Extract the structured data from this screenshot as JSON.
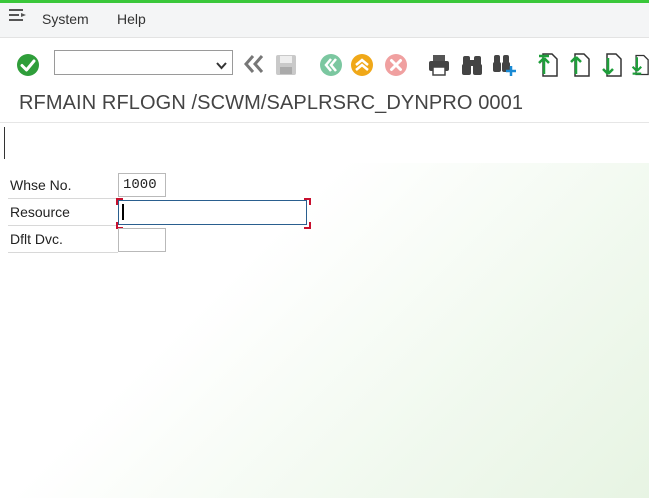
{
  "menu": {
    "system": "System",
    "help": "Help"
  },
  "toolbar": {
    "command_field": {
      "value": "",
      "placeholder": ""
    },
    "icons": [
      "enter-icon",
      "dropdown-icon",
      "double-left-icon",
      "save-icon",
      "back-icon",
      "exit-icon",
      "cancel-icon",
      "print-icon",
      "find-icon",
      "find-next-icon",
      "first-page-icon",
      "previous-page-icon",
      "next-page-icon",
      "last-page-icon"
    ]
  },
  "title": "RFMAIN RFLOGN /SCWM/SAPLRSRC_DYNPRO 0001",
  "form": {
    "whse_label": "Whse No.",
    "whse_value": "1000",
    "resource_label": "Resource",
    "resource_value": "",
    "dflt_label": "Dflt Dvc.",
    "dflt_value": ""
  },
  "colors": {
    "accent_green": "#3ac73a",
    "enter_green": "#2f9e3a",
    "back_green": "#7bc7a0",
    "exit_orange": "#f0a818",
    "cancel_red": "#f0a0a0",
    "focus_red": "#c8102e"
  }
}
